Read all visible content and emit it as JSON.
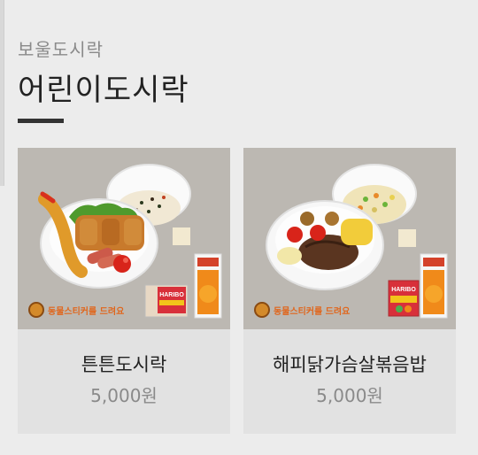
{
  "header": {
    "breadcrumb": "보울도시락",
    "title": "어린이도시락"
  },
  "products": [
    {
      "name": "튼튼도시락",
      "price": "5,000원",
      "sticker": "동물스티커를 드려요",
      "juice": "오렌지",
      "snack": "HARIBO"
    },
    {
      "name": "해피닭가슴살볶음밥",
      "price": "5,000원",
      "sticker": "동물스티커를 드려요",
      "juice": "오렌지",
      "snack": "HARIBO"
    }
  ],
  "colors": {
    "background": "#ececec",
    "card": "#e2e2e2",
    "photo_bg": "#bcb8b2",
    "sticker_text": "#e0661c"
  },
  "icons": [
    "lion-sticker-icon"
  ]
}
